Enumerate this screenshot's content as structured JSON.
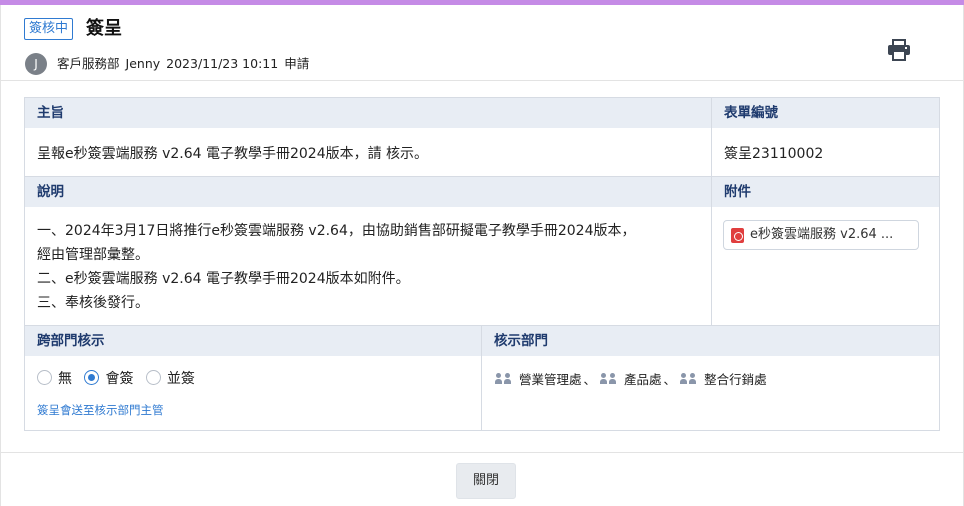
{
  "header": {
    "status_tag": "簽核中",
    "title": "簽呈",
    "avatar_initial": "J",
    "department": "客戶服務部",
    "applicant": "Jenny",
    "datetime": "2023/11/23 10:11",
    "action": "申請",
    "print_icon": "printer-icon"
  },
  "form": {
    "subject_label": "主旨",
    "subject": "呈報e秒簽雲端服務 v2.64 電子教學手冊2024版本，請 核示。",
    "form_no_label": "表單編號",
    "form_no": "簽呈23110002",
    "desc_label": "說明",
    "desc_lines": [
      "一、2024年3月17日將推行e秒簽雲端服務 v2.64，由協助銷售部研擬電子教學手冊2024版本，",
      "經由管理部彙整。",
      "二、e秒簽雲端服務 v2.64 電子教學手冊2024版本如附件。",
      "三、奉核後發行。"
    ],
    "attach_label": "附件",
    "attachment_name": "e秒簽雲端服務 v2.64 ...",
    "cross_dept_label": "跨部門核示",
    "cross_dept_options": [
      "無",
      "會簽",
      "並簽"
    ],
    "cross_dept_selected": "會簽",
    "cross_dept_note": "簽呈會送至核示部門主管",
    "approve_dept_label": "核示部門",
    "approve_depts": [
      "營業管理處",
      "產品處",
      "整合行銷處"
    ]
  },
  "footer": {
    "close_label": "關閉"
  },
  "colors": {
    "accent_bar": "#c58be6",
    "primary": "#2f7ad1",
    "header_bg": "#e8edf4"
  }
}
